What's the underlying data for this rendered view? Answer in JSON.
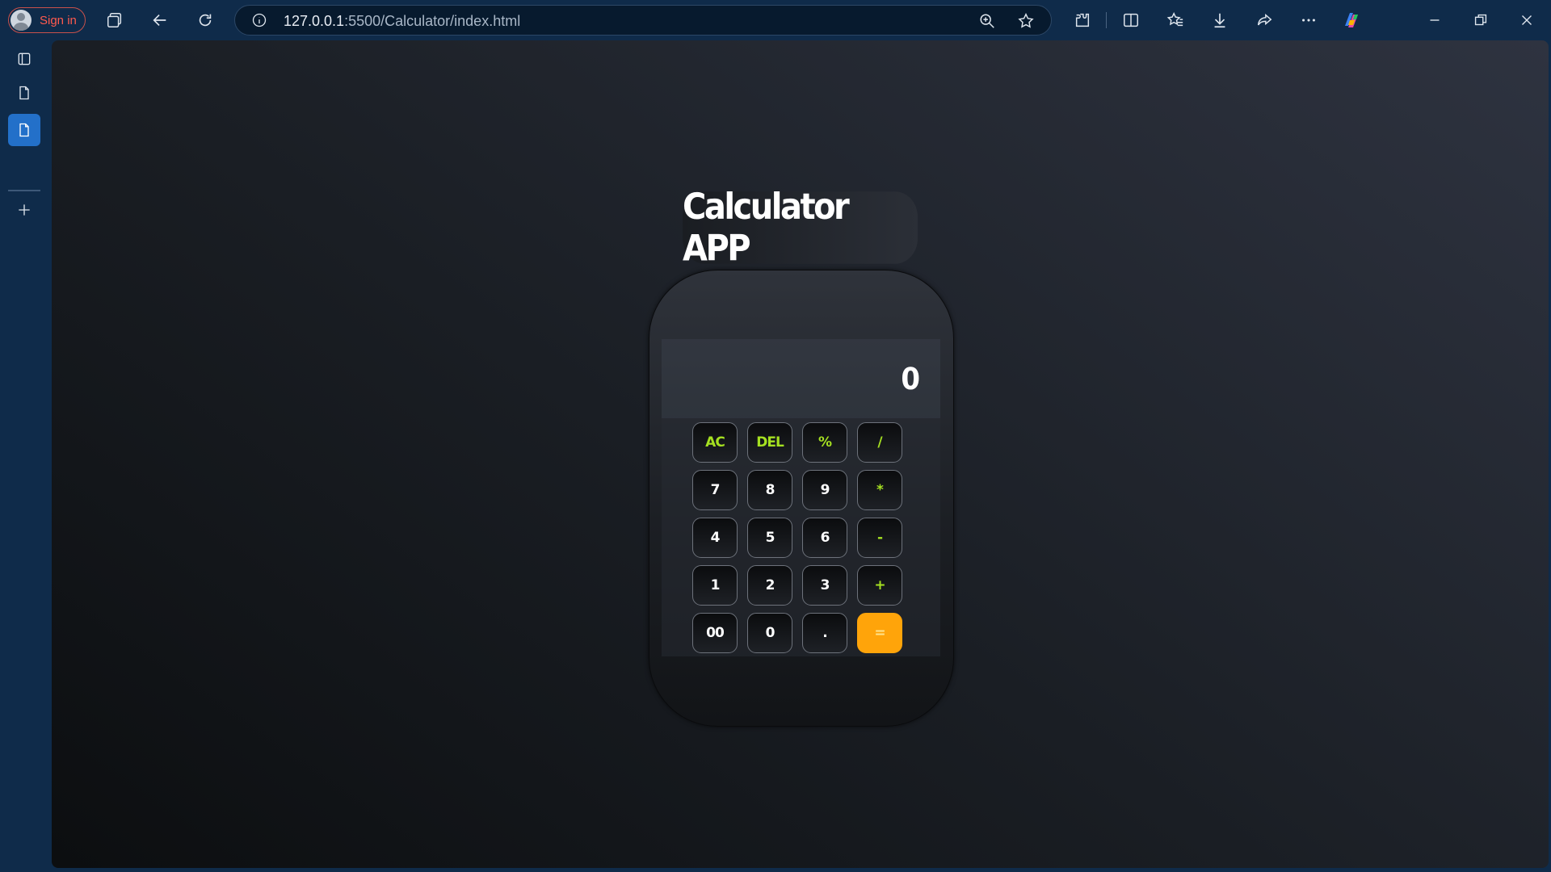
{
  "browser": {
    "profile_label": "Sign in",
    "url_host": "127.0.0.1",
    "url_path": ":5500/Calculator/index.html",
    "accent_color": "#2370c9"
  },
  "page": {
    "title": "Calculator APP",
    "display": "0",
    "keys": [
      [
        "AC",
        "DEL",
        "%",
        "/"
      ],
      [
        "7",
        "8",
        "9",
        "*"
      ],
      [
        "4",
        "5",
        "6",
        "-"
      ],
      [
        "1",
        "2",
        "3",
        "+"
      ],
      [
        "00",
        "0",
        ".",
        "="
      ]
    ],
    "operator_color": "#a5e021",
    "equals_color": "#ffa40a"
  }
}
